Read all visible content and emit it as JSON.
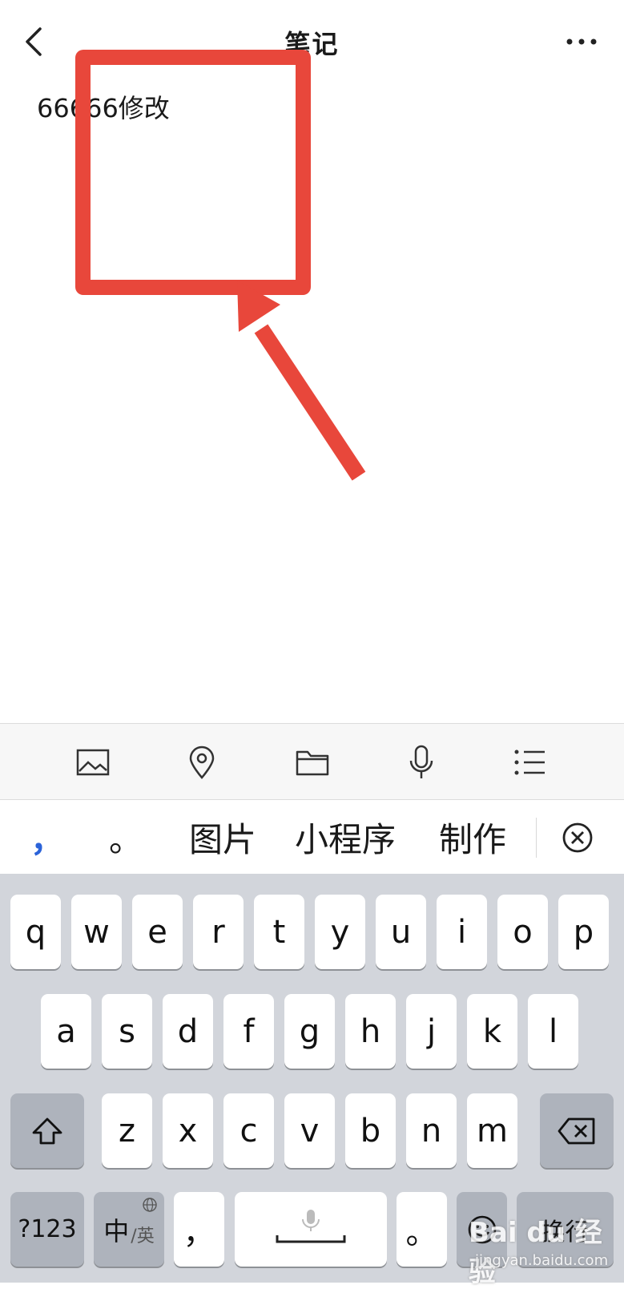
{
  "header": {
    "title": "笔记",
    "back_icon": "chevron-left-icon",
    "more_icon": "more-horizontal-icon"
  },
  "note": {
    "text": "66666修改"
  },
  "annotation": {
    "color": "#e8473b"
  },
  "toolbar": {
    "items": [
      "image-icon",
      "location-icon",
      "folder-icon",
      "microphone-icon",
      "list-icon"
    ]
  },
  "suggestions": {
    "items": [
      "，",
      "。",
      "图片",
      "小程序",
      "制作"
    ],
    "close_icon": "close-circle-icon"
  },
  "keyboard": {
    "row1": [
      "q",
      "w",
      "e",
      "r",
      "t",
      "y",
      "u",
      "i",
      "o",
      "p"
    ],
    "row2": [
      "a",
      "s",
      "d",
      "f",
      "g",
      "h",
      "j",
      "k",
      "l"
    ],
    "row3": [
      "z",
      "x",
      "c",
      "v",
      "b",
      "n",
      "m"
    ],
    "numbers_label": "?123",
    "lang_label_main": "中",
    "lang_label_sub": "/英",
    "comma_label": "，",
    "period_label": "。",
    "return_label": "换行"
  },
  "watermark": {
    "main": "Bai du 经验",
    "sub": "jingyan.baidu.com"
  }
}
